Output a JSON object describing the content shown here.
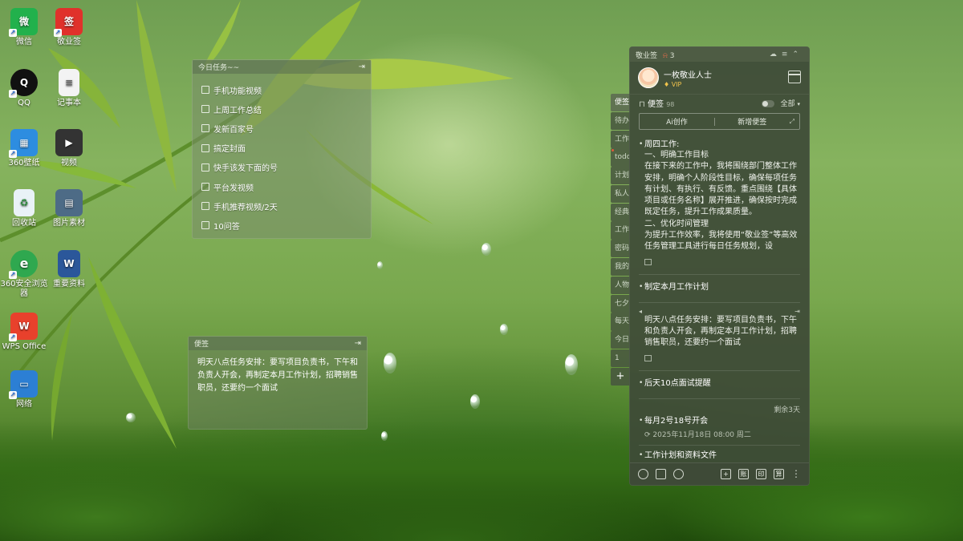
{
  "desktop_icons": [
    {
      "label": "微信",
      "color": "#22b14c",
      "glyph": "微"
    },
    {
      "label": "敬业签",
      "color": "#e0312b",
      "glyph": "签"
    },
    {
      "label": "QQ",
      "color": "#101010",
      "glyph": "Q"
    },
    {
      "label": "记事本",
      "color": "#f3f3f3",
      "glyph": "≡"
    },
    {
      "label": "360壁纸",
      "color": "#2d8de0",
      "glyph": "▦"
    },
    {
      "label": "视频",
      "color": "#333333",
      "glyph": "▶"
    },
    {
      "label": "回收站",
      "color": "#e9f2f7",
      "glyph": "♻"
    },
    {
      "label": "图片素材",
      "color": "#4d6b86",
      "glyph": "▤"
    },
    {
      "label": "360安全浏览器",
      "color": "#2fa84f",
      "glyph": "e"
    },
    {
      "label": "重要资料",
      "color": "#2b579a",
      "glyph": "W"
    },
    {
      "label": "WPS Office",
      "color": "#e8412c",
      "glyph": "W"
    },
    {
      "label": "网络",
      "color": "#2c7fd4",
      "glyph": "▭"
    }
  ],
  "tasks_widget": {
    "title": "今日任务~~",
    "items": [
      "手机功能视频",
      "上周工作总结",
      "发新百家号",
      "搞定封面",
      "快手该发下面的号",
      "平台发视频",
      "手机推荐视频/2天",
      "10问答"
    ]
  },
  "note_widget": {
    "title": "便签",
    "content": "明天八点任务安排：要写项目负责书，下午和负责人开会，再制定本月工作计划，招聘销售职员，还要约一个面试"
  },
  "tab_strip": [
    "便签",
    "待办",
    "工作",
    "todo",
    "计划",
    "私人",
    "经典",
    "工作",
    "密码",
    "我的",
    "人物",
    "七夕",
    "每天",
    "今日",
    "1",
    "+"
  ],
  "panel": {
    "app_name": "敬业签",
    "badge_count": "3",
    "user_name": "一枚敬业人士",
    "vip_label": "VIP",
    "section_label": "便签",
    "section_count": "98",
    "filter_label": "全部",
    "btn_ai": "Ai创作",
    "btn_new": "新增便签",
    "notes": [
      {
        "title": "周四工作:",
        "content": "一、明确工作目标\n在接下来的工作中，我将围绕部门整体工作安排，明确个人阶段性目标，确保每项任务有计划、有执行、有反馈。重点围绕【具体项目或任务名称】展开推进，确保按时完成既定任务，提升工作成果质量。\n二、优化时间管理\n为提升工作效率，我将使用“敬业签”等高效任务管理工具进行每日任务规划，设"
      },
      {
        "title": "制定本月工作计划"
      },
      {
        "content": "明天八点任务安排：要写项目负责书，下午和负责人开会，再制定本月工作计划，招聘销售职员，还要约一个面试"
      },
      {
        "title": "后天10点面试提醒"
      },
      {
        "title": "每月2号18号开会",
        "remain": "剩余3天",
        "meta": "2025年11月18日 08:00 周二"
      },
      {
        "title": "工作计划和资料文件"
      }
    ],
    "footer_icons": [
      "clock-icon",
      "calendar-check-icon",
      "search-icon",
      "add-icon",
      "account-icon",
      "print-icon",
      "calculator-icon",
      "more-icon"
    ],
    "footer_labels": {
      "add": "+",
      "account": "账",
      "print": "印",
      "calc": "算"
    }
  }
}
